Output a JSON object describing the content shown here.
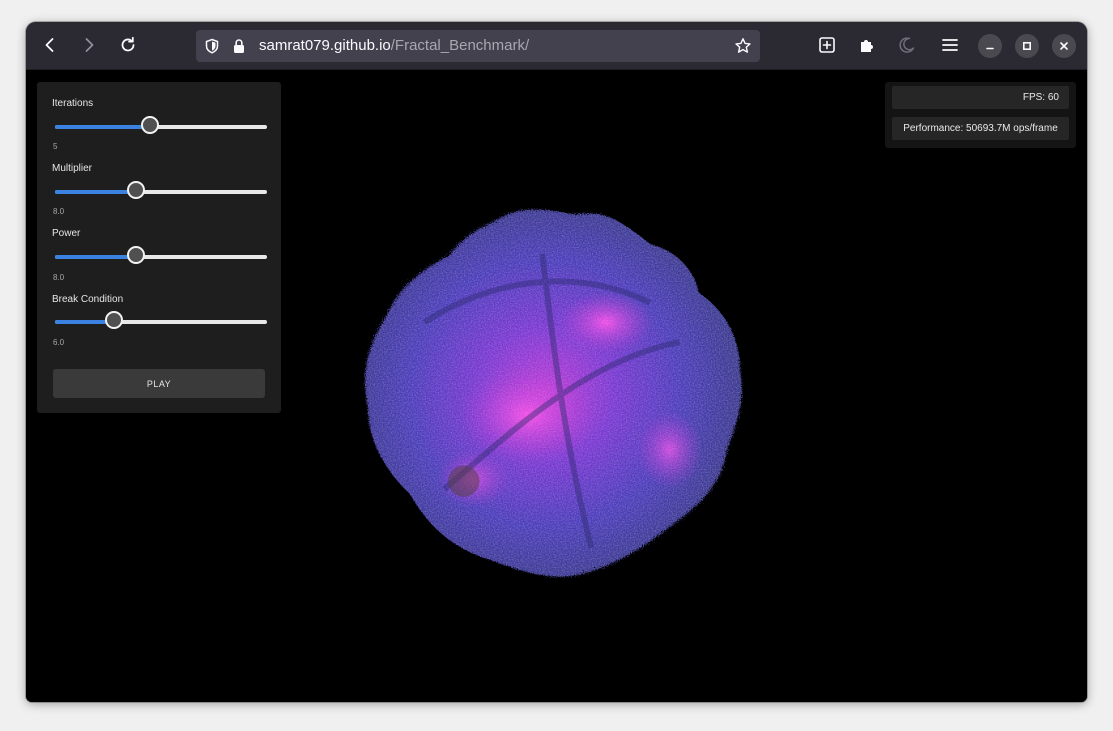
{
  "browser": {
    "url_host": "samrat079.github.io",
    "url_path": "/Fractal_Benchmark/",
    "icons": [
      "back-icon",
      "forward-icon",
      "reload-icon",
      "shield-icon",
      "lock-icon",
      "star-icon",
      "new-tab-icon",
      "extensions-icon",
      "moon-icon",
      "menu-icon",
      "minimize-icon",
      "maximize-icon",
      "close-icon"
    ]
  },
  "controls": {
    "iterations": {
      "label": "Iterations",
      "value": "5",
      "fraction": 0.45
    },
    "multiplier": {
      "label": "Multiplier",
      "value": "8.0",
      "fraction": 0.38
    },
    "power": {
      "label": "Power",
      "value": "8.0",
      "fraction": 0.38
    },
    "break_condition": {
      "label": "Break Condition",
      "value": "6.0",
      "fraction": 0.28
    },
    "play_label": "PLAY"
  },
  "stats": {
    "fps": "FPS: 60",
    "performance": "Performance: 50693.7M ops/frame"
  },
  "colors": {
    "slider_fill": "#3b82e0",
    "fractal_primary": "#5b3fd6",
    "fractal_glow": "#e23ad8"
  }
}
